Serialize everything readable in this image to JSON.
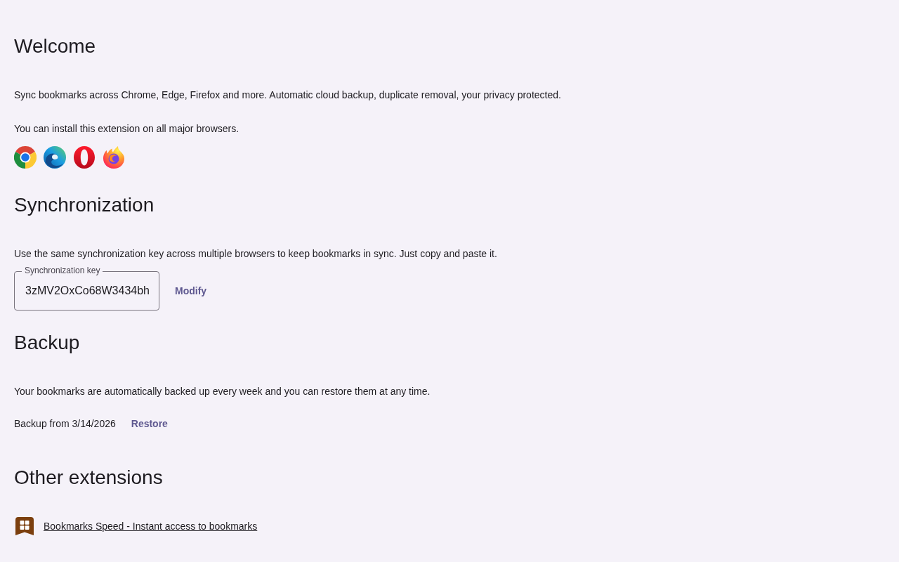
{
  "welcome": {
    "title": "Welcome",
    "paragraphs": [
      "Sync bookmarks across Chrome, Edge, Firefox and more. Automatic cloud backup, duplicate removal, your privacy protected.",
      "You can install this extension on all major browsers."
    ]
  },
  "synchronization": {
    "title": "Synchronization",
    "description": "Use the same synchronization key across multiple browsers to keep bookmarks in sync. Just copy and paste it.",
    "key_field": {
      "label": "Synchronization key",
      "value": "3zMV2OxCo68W3434bh"
    },
    "modify_button": "Modify"
  },
  "backup": {
    "title": "Backup",
    "description": "Your bookmarks are automatically backed up every week and you can restore them at any time.",
    "last_backup": "Backup from 3/14/2026",
    "restore_button": "Restore"
  },
  "other_extensions": {
    "title": "Other extensions",
    "items": [
      {
        "name": "Bookmarks Speed - Instant access to bookmarks"
      }
    ]
  }
}
